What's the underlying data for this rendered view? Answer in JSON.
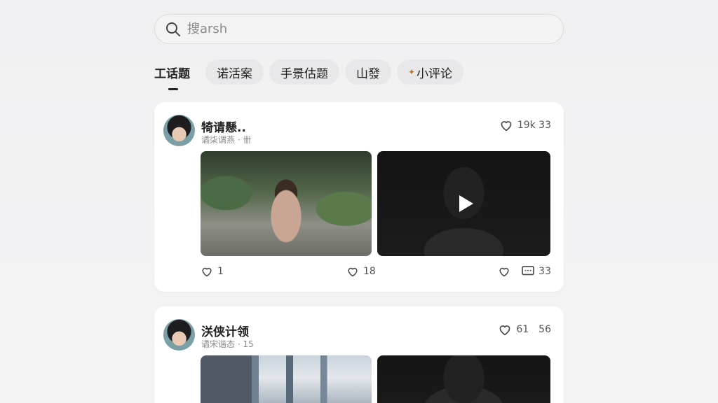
{
  "search": {
    "placeholder": "搜arsh"
  },
  "tabs": [
    {
      "label": "工话题",
      "active": true
    },
    {
      "label": "诺活案"
    },
    {
      "label": "手景估题"
    },
    {
      "label": "山發"
    },
    {
      "label": "小评论",
      "icon": "leaf-icon"
    }
  ],
  "posts": [
    {
      "name": "犄请懸..",
      "sub": "谲柒谓燕 · 卌",
      "likes": "19k 33",
      "actions": {
        "left_likes": "1",
        "mid_likes": "18",
        "comments": "33"
      }
    },
    {
      "name": "浂侠计领",
      "sub": "谲宋谐态 · 15",
      "likes_a": "61",
      "likes_b": "56"
    }
  ]
}
